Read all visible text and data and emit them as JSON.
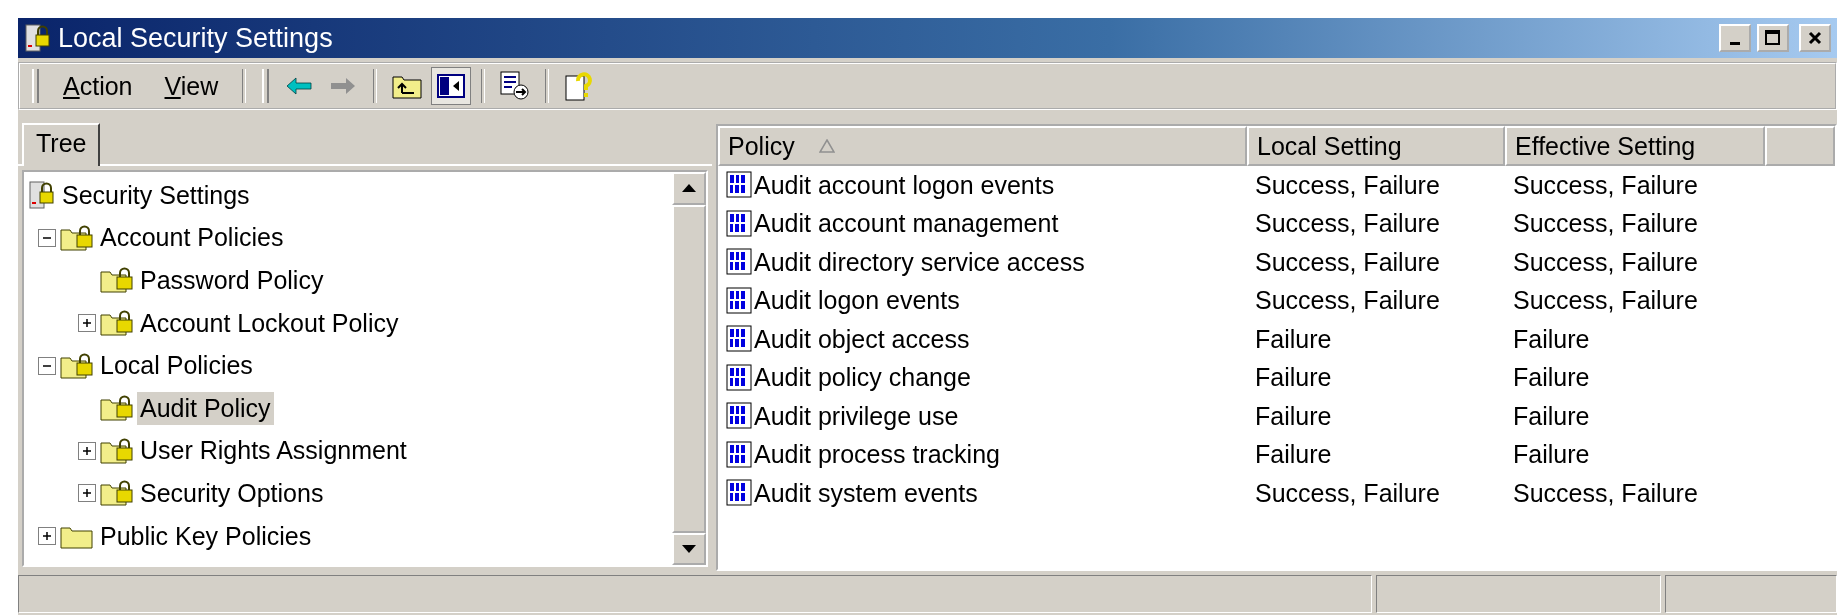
{
  "window": {
    "title": "Local Security Settings"
  },
  "menus": [
    {
      "label": "Action"
    },
    {
      "label": "View"
    }
  ],
  "tools": [
    {
      "kind": "back",
      "disabled": false,
      "pressed": false
    },
    {
      "kind": "forward",
      "disabled": true,
      "pressed": false
    },
    {
      "kind": "up",
      "disabled": false,
      "pressed": false
    },
    {
      "kind": "tree-toggle",
      "disabled": false,
      "pressed": true
    },
    {
      "kind": "export",
      "disabled": false,
      "pressed": false
    },
    {
      "kind": "help",
      "disabled": false,
      "pressed": false
    }
  ],
  "tabs": [
    {
      "label": "Tree",
      "selected": true
    }
  ],
  "tree": [
    {
      "label": "Security Settings",
      "kind": "root",
      "selected": false,
      "children": [
        {
          "label": "Account Policies",
          "kind": "locked",
          "expanded": true,
          "selected": false,
          "children": [
            {
              "label": "Password Policy",
              "kind": "locked",
              "selected": false
            },
            {
              "label": "Account Lockout Policy",
              "kind": "locked",
              "expanded": false,
              "selected": false
            }
          ]
        },
        {
          "label": "Local Policies",
          "kind": "locked",
          "expanded": true,
          "selected": false,
          "children": [
            {
              "label": "Audit Policy",
              "kind": "locked",
              "selected": true
            },
            {
              "label": "User Rights Assignment",
              "kind": "locked",
              "expanded": false,
              "selected": false
            },
            {
              "label": "Security Options",
              "kind": "locked",
              "expanded": false,
              "selected": false
            }
          ]
        },
        {
          "label": "Public Key Policies",
          "kind": "folder",
          "expanded": false,
          "selected": false
        }
      ]
    }
  ],
  "table": {
    "columns": [
      {
        "label": "Policy",
        "sorted": true
      },
      {
        "label": "Local Setting",
        "sorted": false
      },
      {
        "label": "Effective Setting",
        "sorted": false
      }
    ],
    "rows": [
      [
        "Audit account logon events",
        "Success, Failure",
        "Success, Failure"
      ],
      [
        "Audit account management",
        "Success, Failure",
        "Success, Failure"
      ],
      [
        "Audit directory service access",
        "Success, Failure",
        "Success, Failure"
      ],
      [
        "Audit logon events",
        "Success, Failure",
        "Success, Failure"
      ],
      [
        "Audit object access",
        "Failure",
        "Failure"
      ],
      [
        "Audit policy change",
        "Failure",
        "Failure"
      ],
      [
        "Audit privilege use",
        "Failure",
        "Failure"
      ],
      [
        "Audit process tracking",
        "Failure",
        "Failure"
      ],
      [
        "Audit system events",
        "Success, Failure",
        "Success, Failure"
      ]
    ]
  }
}
